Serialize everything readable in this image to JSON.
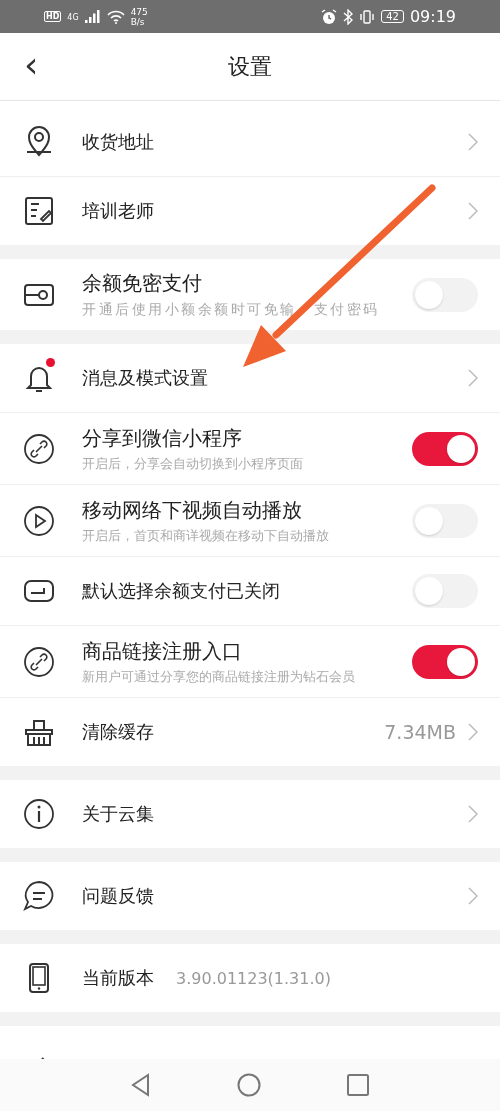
{
  "status_bar": {
    "hd": "HD",
    "network": "4G",
    "speed": "475",
    "speed_unit": "B/s",
    "battery": "42",
    "time": "09:19"
  },
  "header": {
    "back": "‹",
    "title": "设置"
  },
  "sections": [
    {
      "rows": [
        {
          "kind": "link",
          "title": "收货地址"
        },
        {
          "kind": "link",
          "title": "培训老师"
        }
      ]
    },
    {
      "rows": [
        {
          "kind": "toggle",
          "title": "余额免密支付",
          "subtitle": [
            "开通后使用小额余额时可免输",
            "支付密码"
          ],
          "on": false
        }
      ]
    },
    {
      "rows": [
        {
          "kind": "link",
          "title": "消息及模式设置",
          "dot": true
        },
        {
          "kind": "toggle",
          "title": "分享到微信小程序",
          "subtitle": "开启后，分享会自动切换到小程序页面",
          "on": true
        },
        {
          "kind": "toggle",
          "title": "移动网络下视频自动播放",
          "subtitle": "开启后，首页和商详视频在移动下自动播放",
          "on": false
        },
        {
          "kind": "toggle",
          "title": "默认选择余额支付已关闭",
          "on": false
        },
        {
          "kind": "toggle",
          "title": "商品链接注册入口",
          "subtitle": "新用户可通过分享您的商品链接注册为钻石会员",
          "on": true
        },
        {
          "kind": "link",
          "title": "清除缓存",
          "value": "7.34MB"
        }
      ]
    },
    {
      "rows": [
        {
          "kind": "link",
          "title": "关于云集"
        }
      ]
    },
    {
      "rows": [
        {
          "kind": "link",
          "title": "问题反馈"
        }
      ]
    },
    {
      "rows": [
        {
          "kind": "info",
          "title": "当前版本",
          "value": "3.90.01123(1.31.0)"
        }
      ]
    }
  ]
}
